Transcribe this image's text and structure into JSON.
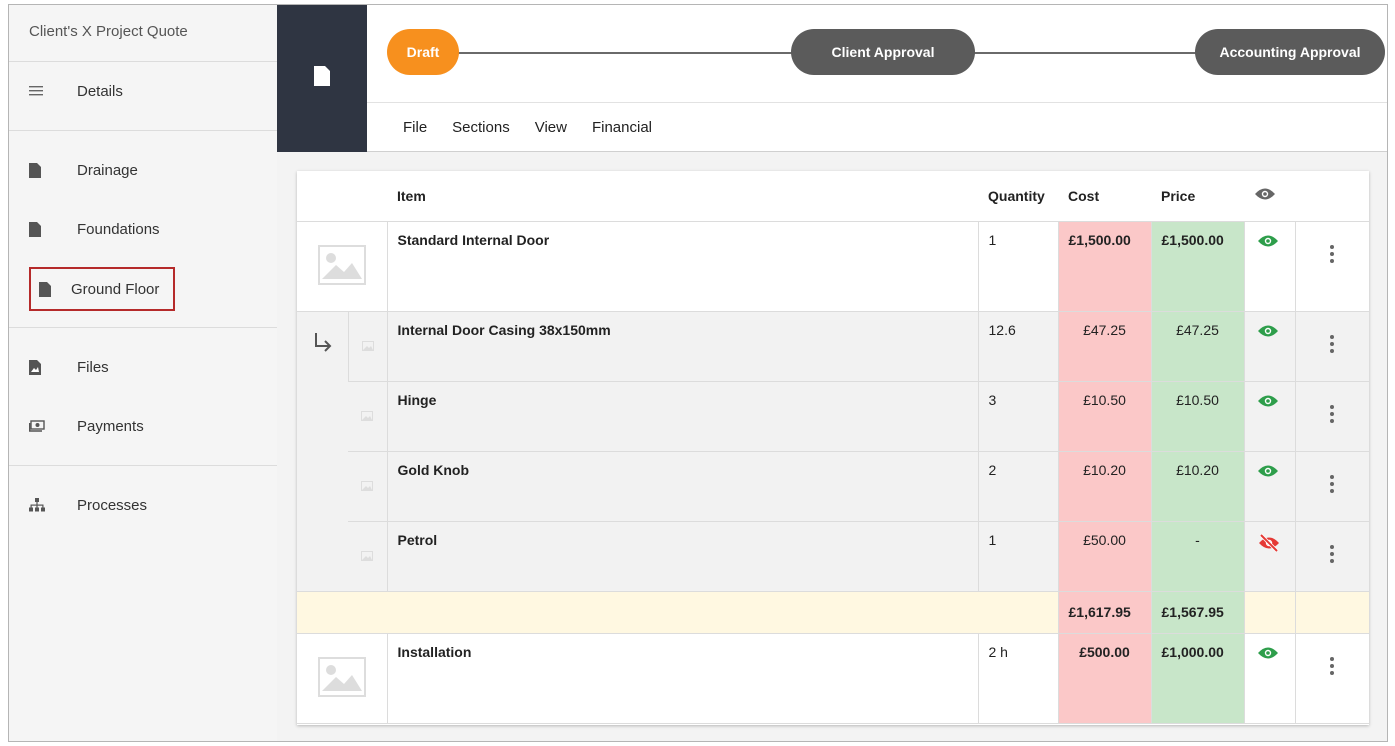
{
  "sidebar": {
    "title": "Client's X Project Quote",
    "items": [
      {
        "label": "Details",
        "icon": "menu-lines-icon"
      },
      {
        "label": "Drainage",
        "icon": "document-icon"
      },
      {
        "label": "Foundations",
        "icon": "document-icon"
      },
      {
        "label": "Ground Floor",
        "icon": "document-icon",
        "selected": true
      },
      {
        "label": "Files",
        "icon": "file-image-icon"
      },
      {
        "label": "Payments",
        "icon": "money-icon"
      },
      {
        "label": "Processes",
        "icon": "sitemap-icon"
      }
    ]
  },
  "workflow": {
    "steps": [
      {
        "label": "Draft",
        "color": "#f7901e",
        "active": true
      },
      {
        "label": "Client Approval",
        "color": "#5b5b5b"
      },
      {
        "label": "Accounting Approval",
        "color": "#5b5b5b"
      }
    ]
  },
  "menu": [
    "File",
    "Sections",
    "View",
    "Financial"
  ],
  "table": {
    "headers": {
      "item": "Item",
      "quantity": "Quantity",
      "cost": "Cost",
      "price": "Price",
      "visibility_icon": "eye-icon"
    },
    "rows": [
      {
        "type": "parent",
        "name": "Standard Internal Door",
        "quantity": "1",
        "cost": "£1,500.00",
        "price": "£1,500.00",
        "visible": true
      },
      {
        "type": "child",
        "name": "Internal Door Casing 38x150mm",
        "quantity": "12.6",
        "cost": "£47.25",
        "price": "£47.25",
        "visible": true
      },
      {
        "type": "child",
        "name": "Hinge",
        "quantity": "3",
        "cost": "£10.50",
        "price": "£10.50",
        "visible": true
      },
      {
        "type": "child",
        "name": "Gold Knob",
        "quantity": "2",
        "cost": "£10.20",
        "price": "£10.20",
        "visible": true
      },
      {
        "type": "child",
        "name": "Petrol",
        "quantity": "1",
        "cost": "£50.00",
        "price": "-",
        "visible": false
      },
      {
        "type": "total",
        "cost": "£1,617.95",
        "price": "£1,567.95"
      },
      {
        "type": "parent",
        "name": "Installation",
        "quantity": "2 h",
        "cost": "£500.00",
        "price": "£1,000.00",
        "visible": true
      }
    ]
  },
  "colors": {
    "cost_bg": "#fbc8c8",
    "price_bg": "#c8e6c9",
    "total_bg": "#fff8e1",
    "eye_visible": "#2e9e4b",
    "eye_hidden": "#e53935",
    "dark_tab": "#2f3542"
  }
}
